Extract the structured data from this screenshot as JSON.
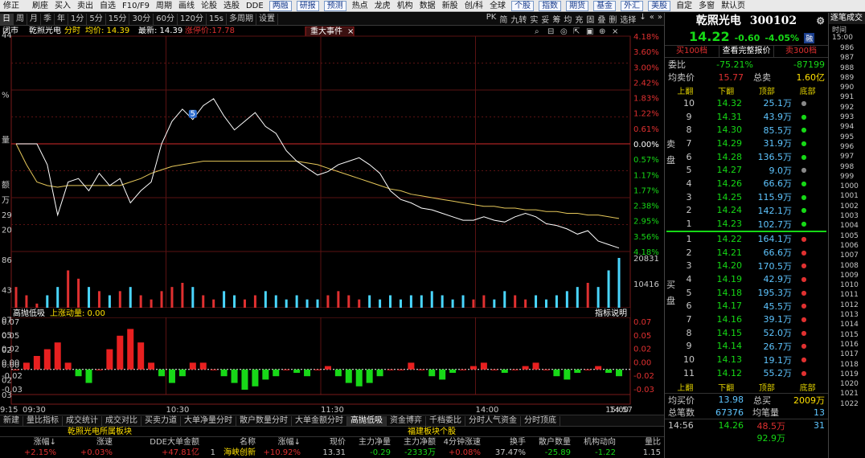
{
  "toolbar": [
    {
      "label": "修正",
      "boxed": false
    },
    {
      "label": "",
      "boxed": false
    },
    {
      "label": "刷座",
      "boxed": false
    },
    {
      "label": "买入",
      "boxed": false
    },
    {
      "label": "卖出",
      "boxed": false
    },
    {
      "label": "自选",
      "boxed": false
    },
    {
      "label": "F10/F9",
      "boxed": false
    },
    {
      "label": "周期",
      "boxed": false
    },
    {
      "label": "画线",
      "boxed": false
    },
    {
      "label": "论股",
      "boxed": false
    },
    {
      "label": "选股",
      "boxed": false
    },
    {
      "label": "DDE",
      "boxed": false
    },
    {
      "label": "两融",
      "boxed": true
    },
    {
      "label": "研报",
      "boxed": true
    },
    {
      "label": "预测",
      "boxed": true
    },
    {
      "label": "热点",
      "boxed": false
    },
    {
      "label": "龙虎",
      "boxed": false
    },
    {
      "label": "机构",
      "boxed": false
    },
    {
      "label": "数据",
      "boxed": false
    },
    {
      "label": "新股",
      "boxed": false
    },
    {
      "label": "创/科",
      "boxed": false
    },
    {
      "label": "全球",
      "boxed": false
    },
    {
      "label": "个股",
      "boxed": true
    },
    {
      "label": "指数",
      "boxed": true
    },
    {
      "label": "期货",
      "boxed": true
    },
    {
      "label": "基金",
      "boxed": true
    },
    {
      "label": "外汇",
      "boxed": true
    },
    {
      "label": "美股",
      "boxed": true
    },
    {
      "label": "自定",
      "boxed": false
    },
    {
      "label": "多窗",
      "boxed": false
    },
    {
      "label": "默认页",
      "boxed": false
    }
  ],
  "periodbar": {
    "items": [
      "日",
      "周",
      "月",
      "季",
      "年",
      "1分",
      "5分",
      "15分",
      "30分",
      "60分",
      "120分",
      "15s",
      "多周期",
      "设置"
    ],
    "active": "日",
    "right": [
      "PK",
      "简",
      "九转",
      "实",
      "妥",
      "筹",
      "均",
      "充",
      "固",
      "叠",
      "删",
      "选择",
      "↓",
      "«",
      "»"
    ]
  },
  "chart": {
    "stock_label": "闭市",
    "stock_name": "乾照光电",
    "mode": "分时",
    "avg_label": "均价: 14.39",
    "last_label": "最新: 14.39",
    "chg_label": "涨停价:17.78",
    "event_tab": "重大事件",
    "left_pct": [
      "44",
      "",
      "",
      "",
      "%",
      "",
      "",
      "量",
      "",
      "",
      "额",
      "万",
      "29",
      "20",
      "",
      "86",
      "",
      "43",
      "",
      "07",
      "05",
      "02",
      "0.00",
      "02",
      "03"
    ],
    "right_axis": [
      "4.18%",
      "3.60%",
      "3.00%",
      "2.42%",
      "1.83%",
      "1.22%",
      "0.61%",
      "0.00%",
      "0.57%",
      "1.17%",
      "1.77%",
      "2.38%",
      "2.95%",
      "3.56%",
      "4.18%"
    ],
    "vol_labels": [
      "20831",
      "10416"
    ],
    "ind_title": "高抛低吸",
    "ind_sub": "上涨动量: 0.00",
    "ind_help": "指标说明",
    "ind_labels": [
      "0.07",
      "0.05",
      "0.02",
      "0.00",
      "-0.02",
      "-0.03"
    ],
    "time_labels": [
      "9:15",
      "09:30",
      "10:30",
      "11:30",
      "14:00",
      "14:57",
      "15:00"
    ],
    "marker": "5",
    "price_series": [
      14.82,
      14.82,
      14.82,
      14.7,
      14.41,
      14.6,
      14.62,
      14.55,
      14.65,
      14.58,
      14.62,
      14.48,
      14.55,
      14.6,
      14.82,
      14.95,
      15.02,
      14.96,
      15.04,
      15.08,
      14.98,
      14.9,
      14.95,
      15.0,
      14.92,
      14.88,
      14.78,
      14.72,
      14.68,
      14.64,
      14.66,
      14.7,
      14.72,
      14.74,
      14.7,
      14.65,
      14.55,
      14.5,
      14.48,
      14.45,
      14.44,
      14.42,
      14.4,
      14.38,
      14.38,
      14.4,
      14.38,
      14.37,
      14.4,
      14.42,
      14.4,
      14.36,
      14.35,
      14.33,
      14.3,
      14.32,
      14.26,
      14.24,
      14.22
    ],
    "avg_series": [
      14.82,
      14.7,
      14.6,
      14.58,
      14.57,
      14.58,
      14.58,
      14.58,
      14.58,
      14.58,
      14.58,
      14.6,
      14.62,
      14.65,
      14.67,
      14.69,
      14.7,
      14.71,
      14.72,
      14.72,
      14.72,
      14.72,
      14.72,
      14.72,
      14.72,
      14.72,
      14.72,
      14.72,
      14.71,
      14.7,
      14.68,
      14.66,
      14.64,
      14.62,
      14.6,
      14.58,
      14.56,
      14.55,
      14.53,
      14.52,
      14.51,
      14.5,
      14.49,
      14.48,
      14.47,
      14.46,
      14.46,
      14.45,
      14.45,
      14.44,
      14.44,
      14.43,
      14.43,
      14.42,
      14.42,
      14.41,
      14.41,
      14.4,
      14.39
    ],
    "volume_series": [
      5,
      3,
      1,
      3,
      5,
      9,
      7,
      5,
      4,
      3,
      4,
      5,
      3,
      2,
      4,
      5,
      6,
      5,
      3,
      2,
      4,
      3,
      2,
      3,
      4,
      3,
      2,
      3,
      2,
      2,
      3,
      4,
      3,
      2,
      3,
      2,
      3,
      2,
      3,
      3,
      4,
      3,
      2,
      3,
      2,
      3,
      2,
      4,
      3,
      2,
      3,
      2,
      3,
      4,
      5,
      6,
      5,
      9,
      12
    ],
    "indicator_series": [
      0.0,
      0.01,
      0.02,
      0.03,
      0.04,
      0.01,
      -0.01,
      -0.02,
      0.0,
      0.03,
      0.05,
      0.06,
      0.04,
      0.01,
      -0.01,
      -0.02,
      -0.01,
      0.01,
      0.01,
      0.0,
      -0.01,
      -0.02,
      -0.03,
      -0.025,
      -0.015,
      -0.01,
      0.0,
      -0.005,
      -0.01,
      0.0,
      0.005,
      -0.01,
      -0.02,
      -0.025,
      -0.02,
      -0.01,
      0.0,
      0.0,
      0.01,
      0.0,
      -0.01,
      -0.015,
      -0.005,
      0.0,
      0.005,
      0.01,
      0.0,
      -0.005,
      0.0,
      0.005,
      0.01,
      0.0,
      -0.01,
      -0.015,
      -0.005,
      0.0,
      0.005,
      -0.005,
      -0.01
    ]
  },
  "bottomtabs": [
    "新建",
    "量比指标",
    "成交统计",
    "成交对比",
    "买卖力道",
    "大单净量分时",
    "散户数量分时",
    "大单金额分时",
    "高抛低吸",
    "资金博弈",
    "千档委比",
    "分时人气资金",
    "分时顶底"
  ],
  "bottomtabs_active": "高抛低吸",
  "bottompanel": {
    "left_title": "乾照光电所属板块",
    "right_title": "福建板块个股",
    "left_headers": [
      "涨幅↓",
      "涨速",
      "DDE大单金额"
    ],
    "right_headers": [
      "名称",
      "涨幅↓",
      "现价",
      "主力净量",
      "主力净额",
      "4分钟涨速",
      "换手",
      "散户数量",
      "机构动向",
      "量比"
    ],
    "left_row": [
      "+2.15%",
      "+0.03%",
      "+47.81亿"
    ],
    "right_row": [
      "1",
      "海峡创新",
      "+10.92%",
      "13.31",
      "-0.29",
      "-2333万",
      "+0.08%",
      "37.47%",
      "-25.89",
      "-1.22",
      "1.15"
    ]
  },
  "quote": {
    "name": "乾照光电",
    "code": "300102",
    "price": "14.22",
    "change": "-0.60",
    "pct": "-4.05%",
    "tag": "融",
    "btn_buy": "买100档",
    "btn_mid": "查看完整报价",
    "btn_sell": "卖300档",
    "weibi_label": "委比",
    "weibi": "-75.21%",
    "weicha": "-87199",
    "jmj_label": "均卖价",
    "jmj": "15.77",
    "zongmai_label": "总卖",
    "zongmai": "1.60亿",
    "subhdr": [
      "上翻",
      "下翻",
      "顶部",
      "底部"
    ],
    "sell_label": "卖盘",
    "buy_label": "买盘",
    "sells": [
      {
        "lv": "10",
        "price": "14.32",
        "vol": "25.1万",
        "dot": "grey"
      },
      {
        "lv": "9",
        "price": "14.31",
        "vol": "43.9万",
        "dot": "green"
      },
      {
        "lv": "8",
        "price": "14.30",
        "vol": "85.5万",
        "dot": "green"
      },
      {
        "lv": "7",
        "price": "14.29",
        "vol": "31.9万",
        "dot": "green"
      },
      {
        "lv": "6",
        "price": "14.28",
        "vol": "136.5万",
        "dot": "green"
      },
      {
        "lv": "5",
        "price": "14.27",
        "vol": "9.0万",
        "dot": "grey"
      },
      {
        "lv": "4",
        "price": "14.26",
        "vol": "66.6万",
        "dot": "green"
      },
      {
        "lv": "3",
        "price": "14.25",
        "vol": "115.9万",
        "dot": "green"
      },
      {
        "lv": "2",
        "price": "14.24",
        "vol": "142.1万",
        "dot": "green"
      },
      {
        "lv": "1",
        "price": "14.23",
        "vol": "102.7万",
        "dot": "green"
      }
    ],
    "buys": [
      {
        "lv": "1",
        "price": "14.22",
        "vol": "164.1万",
        "dot": "red"
      },
      {
        "lv": "2",
        "price": "14.21",
        "vol": "66.6万",
        "dot": "red"
      },
      {
        "lv": "3",
        "price": "14.20",
        "vol": "170.5万",
        "dot": "red"
      },
      {
        "lv": "4",
        "price": "14.19",
        "vol": "42.9万",
        "dot": "red"
      },
      {
        "lv": "5",
        "price": "14.18",
        "vol": "195.3万",
        "dot": "red"
      },
      {
        "lv": "6",
        "price": "14.17",
        "vol": "45.5万",
        "dot": "red"
      },
      {
        "lv": "7",
        "price": "14.16",
        "vol": "39.1万",
        "dot": "red"
      },
      {
        "lv": "8",
        "price": "14.15",
        "vol": "52.0万",
        "dot": "red"
      },
      {
        "lv": "9",
        "price": "14.14",
        "vol": "26.7万",
        "dot": "red"
      },
      {
        "lv": "10",
        "price": "14.13",
        "vol": "19.1万",
        "dot": "red"
      },
      {
        "lv": "11",
        "price": "14.12",
        "vol": "55.2万",
        "dot": "red"
      }
    ],
    "junmai_label": "均买价",
    "junmai": "13.98",
    "zongmai2_label": "总买",
    "zongmai2": "2009万",
    "zbs_label": "总笔数",
    "zbs": "67376",
    "jbl_label": "均笔量",
    "jbl": "13",
    "last_time": "14:56",
    "last_price": "14.26",
    "last_vol": "48.5万",
    "last_num": "31",
    "last2_vol": "92.9万"
  },
  "ticklist": {
    "title": "逐笔成交",
    "time_hdr": "时间",
    "first": "15:00",
    "rows": [
      "986",
      "987",
      "988",
      "989",
      "990",
      "991",
      "992",
      "993",
      "994",
      "995",
      "996",
      "997",
      "998",
      "999",
      "1000",
      "1001",
      "1002",
      "1003",
      "1004",
      "1005",
      "1006",
      "1007",
      "1008",
      "1009",
      "1010",
      "1011",
      "1012",
      "1013",
      "1014",
      "1015",
      "1016",
      "1017",
      "1018",
      "1019",
      "1020",
      "1021",
      "1022"
    ]
  }
}
